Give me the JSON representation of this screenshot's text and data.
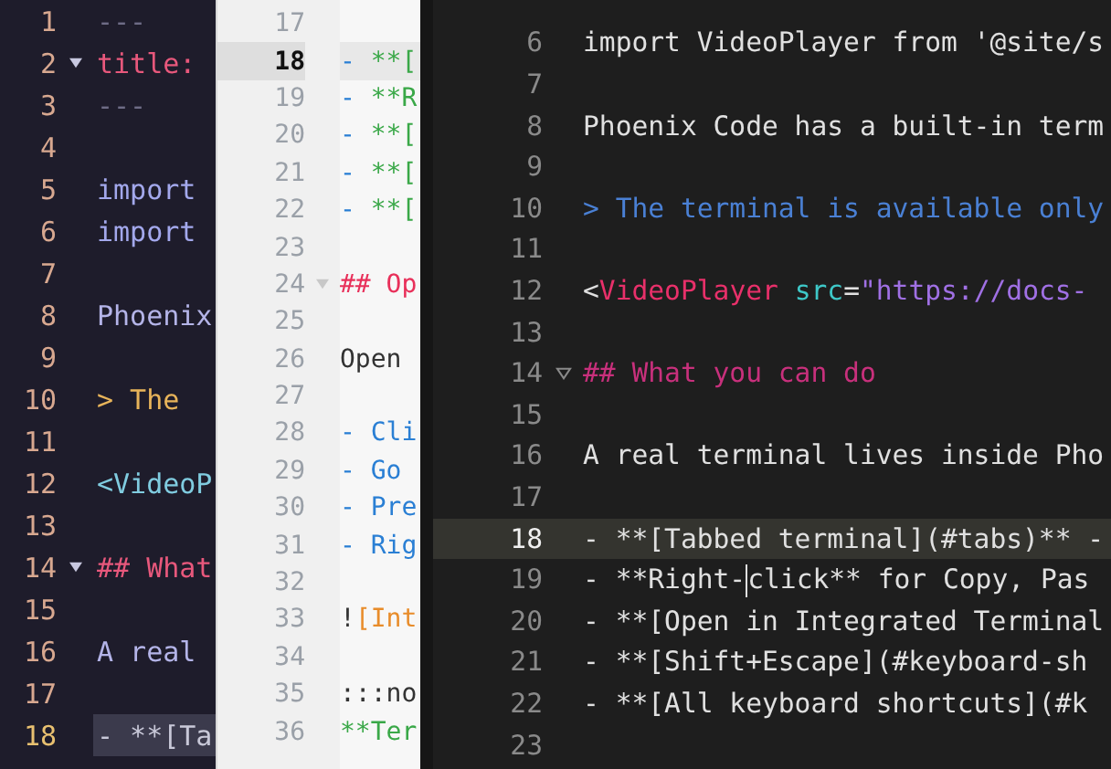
{
  "panes": [
    {
      "kind": "dark-purple",
      "lines": [
        {
          "number": "1",
          "fold": false,
          "selected": false,
          "tokens": [
            {
              "text": "---",
              "kind": "comment"
            }
          ]
        },
        {
          "number": "2",
          "fold": true,
          "selected": false,
          "tokens": [
            {
              "text": "title:",
              "kind": "heading"
            }
          ]
        },
        {
          "number": "3",
          "fold": false,
          "selected": false,
          "tokens": [
            {
              "text": "---",
              "kind": "comment"
            }
          ]
        },
        {
          "number": "4",
          "fold": false,
          "selected": false
        },
        {
          "number": "5",
          "fold": false,
          "selected": false,
          "tokens": [
            {
              "text": "import",
              "kind": "keyword"
            }
          ]
        },
        {
          "number": "6",
          "fold": false,
          "selected": false,
          "tokens": [
            {
              "text": "import",
              "kind": "keyword"
            }
          ]
        },
        {
          "number": "7",
          "fold": false,
          "selected": false
        },
        {
          "number": "8",
          "fold": false,
          "selected": false,
          "tokens": [
            {
              "text": "Phoenix",
              "kind": "text"
            }
          ]
        },
        {
          "number": "9",
          "fold": false,
          "selected": false
        },
        {
          "number": "10",
          "fold": false,
          "selected": false,
          "tokens": [
            {
              "text": "> The",
              "kind": "quote"
            }
          ]
        },
        {
          "number": "11",
          "fold": false,
          "selected": false
        },
        {
          "number": "12",
          "fold": false,
          "selected": false,
          "tokens": [
            {
              "text": "<VideoP",
              "kind": "tag"
            }
          ]
        },
        {
          "number": "13",
          "fold": false,
          "selected": false
        },
        {
          "number": "14",
          "fold": true,
          "selected": false,
          "tokens": [
            {
              "text": "## What",
              "kind": "heading"
            }
          ]
        },
        {
          "number": "15",
          "fold": false,
          "selected": false
        },
        {
          "number": "16",
          "fold": false,
          "selected": false,
          "tokens": [
            {
              "text": "A real",
              "kind": "text"
            }
          ]
        },
        {
          "number": "17",
          "fold": false,
          "selected": false
        },
        {
          "number": "18",
          "fold": false,
          "selected": true,
          "tokens": [
            {
              "text": "- **[Ta",
              "kind": "muted"
            }
          ]
        }
      ]
    },
    {
      "kind": "light",
      "lines": [
        {
          "number": "17",
          "fold": false,
          "selected": false
        },
        {
          "number": "18",
          "fold": false,
          "selected": true,
          "tokens": [
            {
              "text": "- ",
              "kind": "bullet"
            },
            {
              "text": "**[",
              "kind": "bold"
            }
          ]
        },
        {
          "number": "19",
          "fold": false,
          "selected": false,
          "tokens": [
            {
              "text": "- ",
              "kind": "bullet"
            },
            {
              "text": "**R",
              "kind": "bold"
            }
          ]
        },
        {
          "number": "20",
          "fold": false,
          "selected": false,
          "tokens": [
            {
              "text": "- ",
              "kind": "bullet"
            },
            {
              "text": "**[",
              "kind": "bold"
            }
          ]
        },
        {
          "number": "21",
          "fold": false,
          "selected": false,
          "tokens": [
            {
              "text": "- ",
              "kind": "bullet"
            },
            {
              "text": "**[",
              "kind": "bold"
            }
          ]
        },
        {
          "number": "22",
          "fold": false,
          "selected": false,
          "tokens": [
            {
              "text": "- ",
              "kind": "bullet"
            },
            {
              "text": "**[",
              "kind": "bold"
            }
          ]
        },
        {
          "number": "23",
          "fold": false,
          "selected": false
        },
        {
          "number": "24",
          "fold": true,
          "selected": false,
          "tokens": [
            {
              "text": "## Op",
              "kind": "heading"
            }
          ]
        },
        {
          "number": "25",
          "fold": false,
          "selected": false
        },
        {
          "number": "26",
          "fold": false,
          "selected": false,
          "tokens": [
            {
              "text": "Open",
              "kind": "text"
            }
          ]
        },
        {
          "number": "27",
          "fold": false,
          "selected": false
        },
        {
          "number": "28",
          "fold": false,
          "selected": false,
          "tokens": [
            {
              "text": "- Cli",
              "kind": "bullet"
            }
          ]
        },
        {
          "number": "29",
          "fold": false,
          "selected": false,
          "tokens": [
            {
              "text": "- Go",
              "kind": "bullet"
            }
          ]
        },
        {
          "number": "30",
          "fold": false,
          "selected": false,
          "tokens": [
            {
              "text": "- Pre",
              "kind": "bullet"
            }
          ]
        },
        {
          "number": "31",
          "fold": false,
          "selected": false,
          "tokens": [
            {
              "text": "- Rig",
              "kind": "bullet"
            }
          ]
        },
        {
          "number": "32",
          "fold": false,
          "selected": false
        },
        {
          "number": "33",
          "fold": false,
          "selected": false,
          "tokens": [
            {
              "text": "!",
              "kind": "text"
            },
            {
              "text": "[Int",
              "kind": "link"
            }
          ]
        },
        {
          "number": "34",
          "fold": false,
          "selected": false
        },
        {
          "number": "35",
          "fold": false,
          "selected": false,
          "tokens": [
            {
              "text": ":::no",
              "kind": "text"
            }
          ]
        },
        {
          "number": "36",
          "fold": false,
          "selected": false,
          "tokens": [
            {
              "text": "**Ter",
              "kind": "bold"
            }
          ]
        }
      ]
    },
    {
      "kind": "dark",
      "lines": [
        {
          "number": "6",
          "fold": false,
          "selected": false,
          "tokens": [
            {
              "text": "import VideoPlayer from '@site/s",
              "kind": "text"
            }
          ]
        },
        {
          "number": "7",
          "fold": false,
          "selected": false
        },
        {
          "number": "8",
          "fold": false,
          "selected": false,
          "tokens": [
            {
              "text": "Phoenix Code has a built-in term",
              "kind": "text"
            }
          ]
        },
        {
          "number": "9",
          "fold": false,
          "selected": false
        },
        {
          "number": "10",
          "fold": false,
          "selected": false,
          "tokens": [
            {
              "text": "> The terminal is available only",
              "kind": "quote"
            }
          ]
        },
        {
          "number": "11",
          "fold": false,
          "selected": false
        },
        {
          "number": "12",
          "fold": false,
          "selected": false,
          "tokens": [
            {
              "text": "<",
              "kind": "text"
            },
            {
              "text": "VideoPlayer",
              "kind": "tag"
            },
            {
              "text": " src",
              "kind": "attr"
            },
            {
              "text": "=",
              "kind": "text"
            },
            {
              "text": "\"https://docs-",
              "kind": "string"
            }
          ]
        },
        {
          "number": "13",
          "fold": false,
          "selected": false
        },
        {
          "number": "14",
          "fold": true,
          "selected": false,
          "tokens": [
            {
              "text": "## What you can do",
              "kind": "heading"
            }
          ]
        },
        {
          "number": "15",
          "fold": false,
          "selected": false
        },
        {
          "number": "16",
          "fold": false,
          "selected": false,
          "tokens": [
            {
              "text": "A real terminal lives inside Pho",
              "kind": "text"
            }
          ]
        },
        {
          "number": "17",
          "fold": false,
          "selected": false
        },
        {
          "number": "18",
          "fold": false,
          "selected": true,
          "tokens": [
            {
              "text": "- **[Tabbed terminal](#tabs)** -",
              "kind": "text"
            }
          ]
        },
        {
          "number": "19",
          "fold": false,
          "selected": false,
          "tokens": [
            {
              "text": "- **Right-",
              "kind": "text"
            },
            {
              "kind": "cursor"
            },
            {
              "text": "click** for Copy, Pas",
              "kind": "text"
            }
          ]
        },
        {
          "number": "20",
          "fold": false,
          "selected": false,
          "tokens": [
            {
              "text": "- **[Open in Integrated Terminal",
              "kind": "text"
            }
          ]
        },
        {
          "number": "21",
          "fold": false,
          "selected": false,
          "tokens": [
            {
              "text": "- **[Shift+Escape](#keyboard-sh",
              "kind": "text"
            }
          ]
        },
        {
          "number": "22",
          "fold": false,
          "selected": false,
          "tokens": [
            {
              "text": "- **[All keyboard shortcuts](#k",
              "kind": "text"
            }
          ]
        },
        {
          "number": "23",
          "fold": false,
          "selected": false
        }
      ]
    }
  ]
}
